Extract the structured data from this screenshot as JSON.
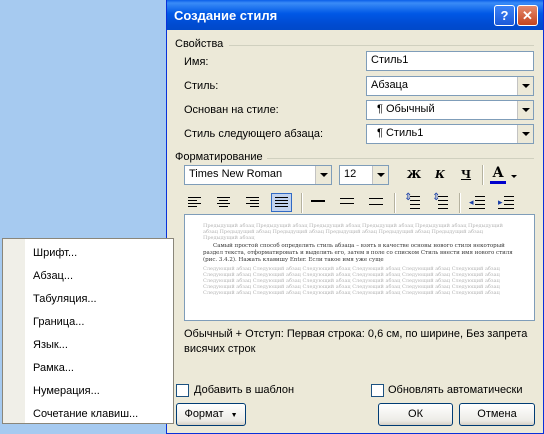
{
  "dialog": {
    "title": "Создание стиля",
    "help_label": "?",
    "close_label": "✕",
    "properties_title": "Свойства",
    "name_label": "Имя:",
    "name_value": "Стиль1",
    "style_label": "Стиль:",
    "style_value": "Абзаца",
    "based_label": "Основан на стиле:",
    "based_value": "¶ Обычный",
    "next_label": "Стиль следующего абзаца:",
    "next_value": "¶ Стиль1",
    "format_title": "Форматирование",
    "font_value": "Times New Roman",
    "size_value": "12",
    "bold_label": "Ж",
    "italic_label": "К",
    "underline_label": "Ч",
    "fontcolor_label": "A",
    "preview_before": "Предыдущий абзац Предыдущий абзац Предыдущий абзац Предыдущий абзац Предыдущий абзац Предыдущий абзац Предыдущий абзац Предыдущий абзац Предыдущий абзац Предыдущий абзац Предыдущий абзац Предыдущий абзац",
    "preview_main": "Самый простой способ определить стиль абзаца – взять в качестве основы нового стиля некоторый раздел текста, отформатировать и выделить его, затем в поле со списком Стиль внести имя нового стиля (рис. 3.4.2). Нажать клавишу Enter. Если такое имя уже суще",
    "preview_after": "Следующий абзац Следующий абзац Следующий абзац Следующий абзац Следующий абзац Следующий абзац Следующий абзац Следующий абзац Следующий абзац Следующий абзац Следующий абзац Следующий абзац Следующий абзац Следующий абзац Следующий абзац Следующий абзац Следующий абзац Следующий абзац Следующий абзац Следующий абзац Следующий абзац Следующий абзац Следующий абзац Следующий абзац Следующий абзац Следующий абзац Следующий абзац Следующий абзац Следующий абзац Следующий абзац",
    "description": "Обычный + Отступ: Первая строка:  0,6 см, по ширине, Без запрета висячих строк",
    "add_to_template": "Добавить в шаблон",
    "auto_update": "Обновлять автоматически",
    "format_button": "Формат",
    "ok_button": "ОК",
    "cancel_button": "Отмена"
  },
  "menu": {
    "items": [
      "Шрифт...",
      "Абзац...",
      "Табуляция...",
      "Граница...",
      "Язык...",
      "Рамка...",
      "Нумерация...",
      "Сочетание клавиш..."
    ]
  },
  "colors": {
    "desktop": "#a6caf0",
    "titlebar": "#0058e6",
    "dialog_bg": "#ece9d8",
    "font_color_underline": "#0000cc"
  },
  "icons": [
    "help-icon",
    "close-icon",
    "align-left-icon",
    "align-center-icon",
    "align-right-icon",
    "justify-icon",
    "line-spacing-single-icon",
    "line-spacing-1-5-icon",
    "line-spacing-double-icon",
    "space-before-icon",
    "space-after-icon",
    "decrease-indent-icon",
    "increase-indent-icon",
    "dropdown-arrow-icon"
  ]
}
